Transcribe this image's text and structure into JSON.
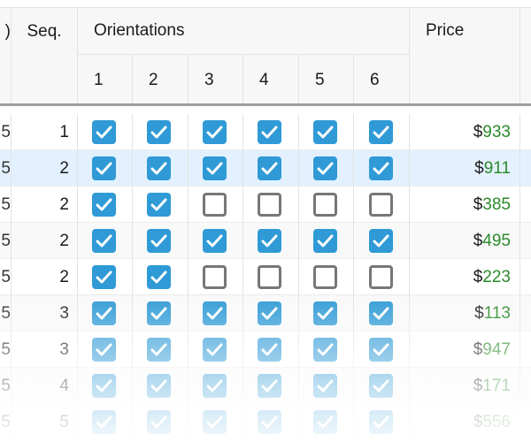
{
  "header": {
    "cut_label": ")",
    "seq_label": "Seq.",
    "orientations_label": "Orientations",
    "orientation_numbers": [
      "1",
      "2",
      "3",
      "4",
      "5",
      "6"
    ],
    "price_label": "Price"
  },
  "colors": {
    "checked": "#2f9ad6",
    "price_digits": "#2a8a2a",
    "selected_row": "#e3f1ff"
  },
  "rows": [
    {
      "cut": "5",
      "seq": "1",
      "orientations": [
        true,
        true,
        true,
        true,
        true,
        true
      ],
      "currency": "$",
      "price": "933"
    },
    {
      "cut": "5",
      "seq": "2",
      "orientations": [
        true,
        true,
        true,
        true,
        true,
        true
      ],
      "currency": "$",
      "price": "911",
      "selected": true
    },
    {
      "cut": "5",
      "seq": "2",
      "orientations": [
        true,
        true,
        false,
        false,
        false,
        false
      ],
      "currency": "$",
      "price": "385"
    },
    {
      "cut": "5",
      "seq": "2",
      "orientations": [
        true,
        true,
        true,
        true,
        true,
        true
      ],
      "currency": "$",
      "price": "495"
    },
    {
      "cut": "5",
      "seq": "2",
      "orientations": [
        true,
        true,
        false,
        false,
        false,
        false
      ],
      "currency": "$",
      "price": "223"
    },
    {
      "cut": "5",
      "seq": "3",
      "orientations": [
        true,
        true,
        true,
        true,
        true,
        true
      ],
      "currency": "$",
      "price": "113"
    },
    {
      "cut": "5",
      "seq": "3",
      "orientations": [
        true,
        true,
        true,
        true,
        true,
        true
      ],
      "currency": "$",
      "price": "947"
    },
    {
      "cut": "5",
      "seq": "4",
      "orientations": [
        true,
        true,
        true,
        true,
        true,
        true
      ],
      "currency": "$",
      "price": "171"
    },
    {
      "cut": "5",
      "seq": "5",
      "orientations": [
        true,
        true,
        true,
        true,
        true,
        true
      ],
      "currency": "$",
      "price": "556"
    }
  ]
}
